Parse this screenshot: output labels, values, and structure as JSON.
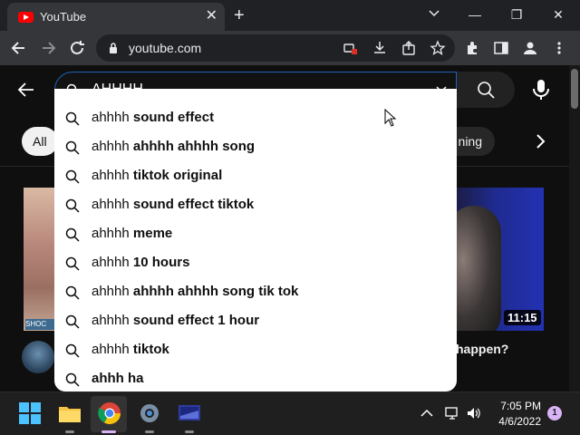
{
  "browser": {
    "tab_title": "YouTube",
    "tab_close": "✕",
    "new_tab": "+",
    "address": "youtube.com",
    "window_minimize": "—",
    "window_restore": "❐",
    "window_close": "✕"
  },
  "youtube": {
    "search_value": "AHHHH",
    "chips": {
      "all": "All",
      "partial": "ning"
    },
    "video": {
      "duration": "11:15",
      "title_partial": "happen?",
      "left_badge": "SHOC"
    }
  },
  "suggestions": [
    {
      "prefix": "ahhhh ",
      "rest": "sound effect"
    },
    {
      "prefix": "ahhhh ",
      "rest": "ahhhh ahhhh song"
    },
    {
      "prefix": "ahhhh ",
      "rest": "tiktok original"
    },
    {
      "prefix": "ahhhh ",
      "rest": "sound effect tiktok"
    },
    {
      "prefix": "ahhhh ",
      "rest": "meme"
    },
    {
      "prefix": "ahhhh ",
      "rest": "10 hours"
    },
    {
      "prefix": "ahhhh ",
      "rest": "ahhhh ahhhh song tik tok"
    },
    {
      "prefix": "ahhhh ",
      "rest": "sound effect 1 hour"
    },
    {
      "prefix": "ahhhh ",
      "rest": "tiktok"
    },
    {
      "prefix": "",
      "rest": "ahhh ha"
    }
  ],
  "taskbar": {
    "time": "7:05 PM",
    "date": "4/6/2022",
    "notifications": "1"
  },
  "colors": {
    "youtube_red": "#ff0000",
    "focus_blue": "#1c62b9",
    "chrome_dark": "#35363a"
  }
}
